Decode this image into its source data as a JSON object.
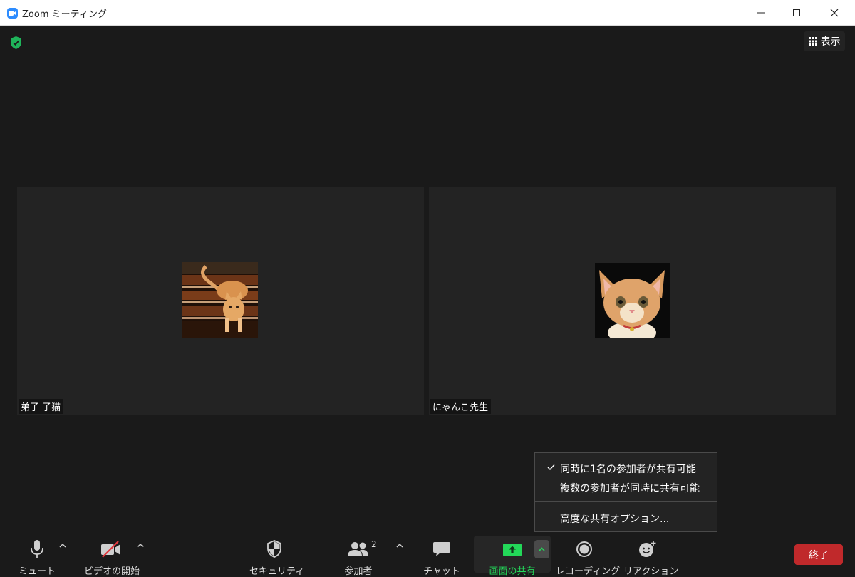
{
  "window": {
    "title": "Zoom ミーティング"
  },
  "header": {
    "view_label": "表示"
  },
  "participants": [
    {
      "name": "弟子 子猫"
    },
    {
      "name": "にゃんこ先生"
    }
  ],
  "share_menu": {
    "items": [
      {
        "label": "同時に1名の参加者が共有可能",
        "checked": true
      },
      {
        "label": "複数の参加者が同時に共有可能",
        "checked": false
      },
      {
        "label": "高度な共有オプション..."
      }
    ]
  },
  "toolbar": {
    "mute_label": "ミュート",
    "video_label": "ビデオの開始",
    "security_label": "セキュリティ",
    "participants_label": "参加者",
    "participants_count": "2",
    "chat_label": "チャット",
    "share_label": "画面の共有",
    "record_label": "レコーディング",
    "reactions_label": "リアクション",
    "end_label": "終了"
  },
  "colors": {
    "share_green": "#23d959",
    "end_red": "#c0292b",
    "secure_green": "#1fb45a",
    "zoom_blue": "#2d8cff"
  }
}
